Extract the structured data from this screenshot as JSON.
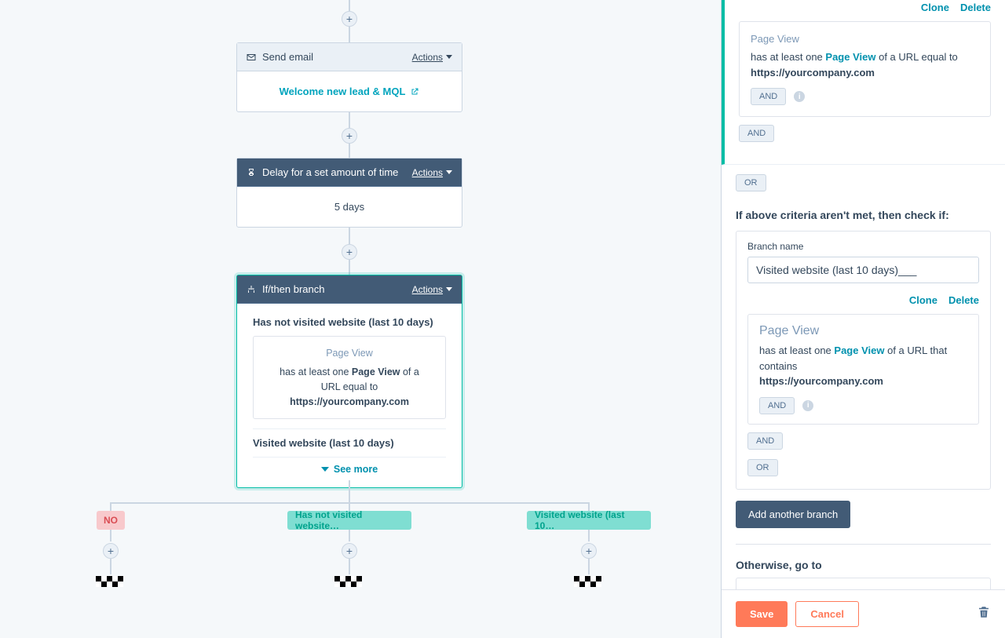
{
  "labels": {
    "actions": "Actions",
    "clone": "Clone",
    "delete": "Delete",
    "and": "AND",
    "or": "OR",
    "save": "Save",
    "cancel": "Cancel",
    "see_more": "See more",
    "add_branch": "Add another branch",
    "branch_name_label": "Branch name",
    "page_view": "Page View",
    "if_above": "If above criteria aren't met, then check if:",
    "otherwise": "Otherwise, go to"
  },
  "nodes": {
    "email": {
      "title": "Send email",
      "link_text": "Welcome new lead & MQL"
    },
    "delay": {
      "title": "Delay for a set amount of time",
      "body": "5 days"
    },
    "branch": {
      "title": "If/then branch",
      "b1_name": "Has not visited website (last 10 days)",
      "b2_name": "Visited website (last 10 days)",
      "filter": {
        "title": "Page View",
        "prefix": "has at least one ",
        "bold1": "Page View",
        "mid": " of a URL equal to ",
        "url": "https://yourcompany.com"
      }
    }
  },
  "tags": {
    "no": "NO",
    "b1": "Has not visited website…",
    "b2": "Visited website (last 10…"
  },
  "sidebar": {
    "crit1": {
      "pv": "Page View",
      "prefix": "has at least one ",
      "link": "Page View",
      "mid": " of a URL equal to ",
      "url": "https://yourcompany.com"
    },
    "branch2": {
      "name_value": "Visited website (last 10 days)___",
      "pv": "Page View",
      "prefix": "has at least one ",
      "link": "Page View",
      "mid": " of a URL that contains ",
      "url": "https://yourcompany.com"
    }
  }
}
